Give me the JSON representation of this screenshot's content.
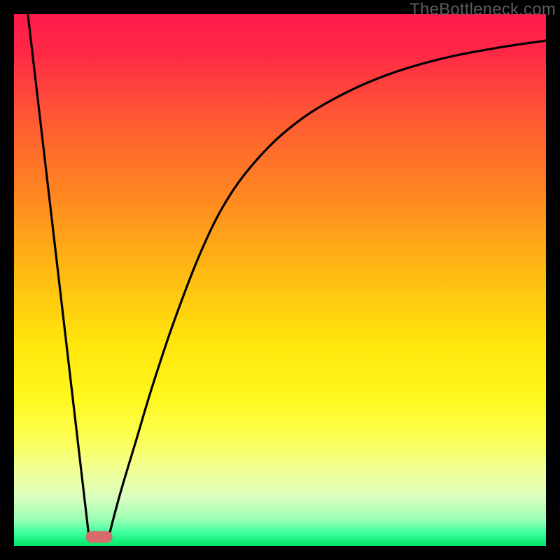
{
  "watermark": "TheBottleneck.com",
  "chart_data": {
    "type": "line",
    "title": "",
    "xlabel": "",
    "ylabel": "",
    "xlim": [
      0,
      100
    ],
    "ylim": [
      0,
      100
    ],
    "background_gradient": {
      "stops": [
        {
          "offset": 0.0,
          "color": "#ff1a4b"
        },
        {
          "offset": 0.07,
          "color": "#ff2846"
        },
        {
          "offset": 0.2,
          "color": "#ff5a33"
        },
        {
          "offset": 0.35,
          "color": "#ff8a1f"
        },
        {
          "offset": 0.5,
          "color": "#ffbf12"
        },
        {
          "offset": 0.62,
          "color": "#ffe60c"
        },
        {
          "offset": 0.72,
          "color": "#fff71e"
        },
        {
          "offset": 0.8,
          "color": "#fcff55"
        },
        {
          "offset": 0.86,
          "color": "#f1ff9a"
        },
        {
          "offset": 0.91,
          "color": "#d9ffc0"
        },
        {
          "offset": 0.95,
          "color": "#9affb4"
        },
        {
          "offset": 0.975,
          "color": "#3effa0"
        },
        {
          "offset": 1.0,
          "color": "#00e765"
        }
      ]
    },
    "series": [
      {
        "name": "left-branch",
        "x": [
          2.6,
          14.0
        ],
        "y": [
          100,
          2.5
        ]
      },
      {
        "name": "right-branch",
        "x": [
          18,
          20,
          23,
          26,
          30,
          35,
          40,
          46,
          53,
          61,
          70,
          80,
          90,
          100
        ],
        "y": [
          2.5,
          10,
          20,
          30,
          42,
          55,
          65,
          73,
          79.5,
          84.5,
          88.5,
          91.5,
          93.5,
          95
        ]
      }
    ],
    "marker": {
      "x": 16.0,
      "y": 1.7,
      "width": 5.0,
      "height": 2.2,
      "rx": 1.1,
      "fill": "#d76a6a"
    },
    "axes_color": "#000000",
    "curve_color": "#000000",
    "curve_width": 3.2
  }
}
